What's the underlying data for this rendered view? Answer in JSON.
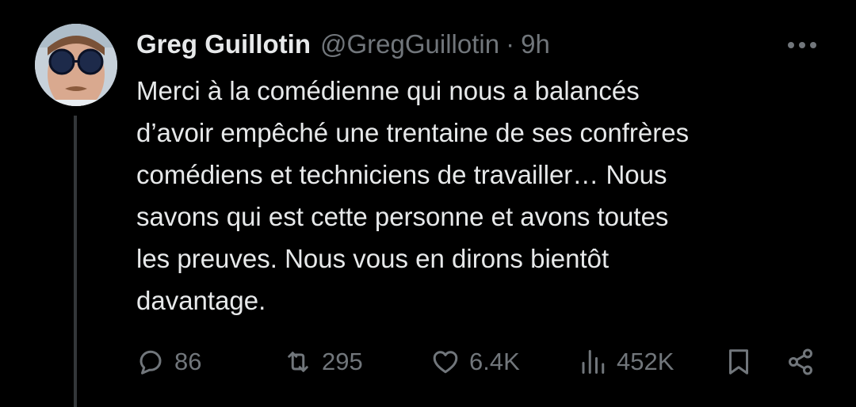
{
  "post": {
    "author_name": "Greg Guillotin",
    "author_handle": "@GregGuillotin",
    "separator": "·",
    "timestamp": "9h",
    "text": "Merci à la comédienne qui nous a balancés\nd’avoir empêché une trentaine de ses confrères\ncomédiens et techniciens de travailler… Nous\nsavons qui est cette personne et avons toutes\nles preuves. Nous vous en dirons bientôt\ndavantage."
  },
  "actions": {
    "replies": "86",
    "reposts": "295",
    "likes": "6.4K",
    "views": "452K"
  },
  "icons": {
    "more": "more-horizontal-icon",
    "reply": "reply-bubble-icon",
    "repost": "repost-icon",
    "like": "heart-icon",
    "views": "bar-chart-icon",
    "bookmark": "bookmark-icon",
    "share": "share-icon"
  },
  "colors": {
    "background": "#000000",
    "text_primary": "#e7e9ea",
    "text_secondary": "#71767b",
    "thread_line": "#333639"
  }
}
